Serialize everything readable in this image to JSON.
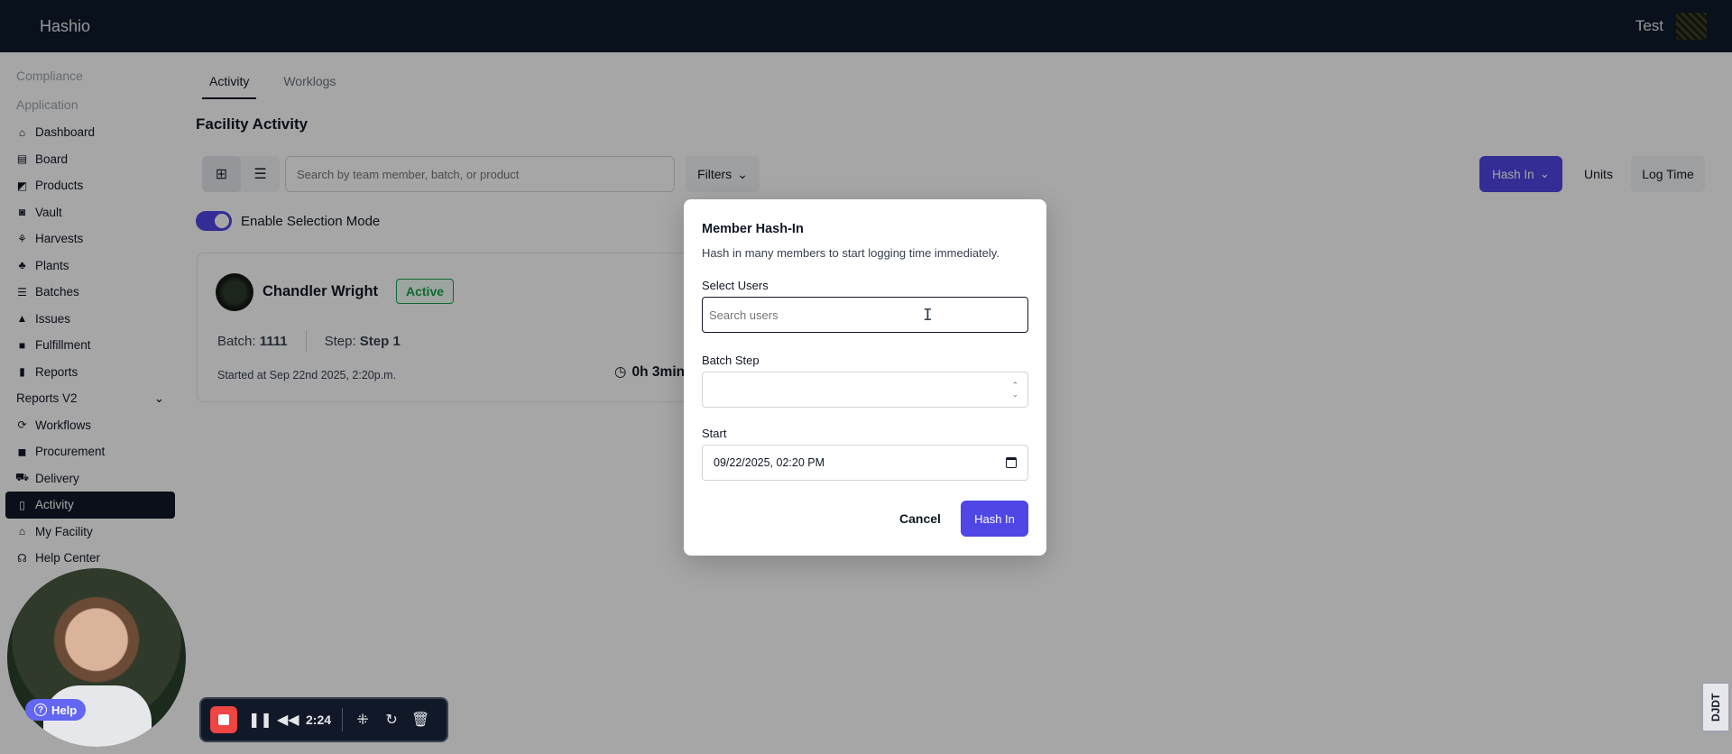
{
  "app": {
    "brand": "Hashio",
    "user_name": "Test"
  },
  "sidebar": {
    "sections": [
      "Compliance",
      "Application"
    ],
    "items": [
      {
        "label": "Dashboard",
        "icon": "home-icon",
        "glyph": "⌂"
      },
      {
        "label": "Board",
        "icon": "board-icon",
        "glyph": "▤"
      },
      {
        "label": "Products",
        "icon": "products-icon",
        "glyph": "◩"
      },
      {
        "label": "Vault",
        "icon": "vault-icon",
        "glyph": "◙"
      },
      {
        "label": "Harvests",
        "icon": "harvests-icon",
        "glyph": "⚘"
      },
      {
        "label": "Plants",
        "icon": "plants-icon",
        "glyph": "♣"
      },
      {
        "label": "Batches",
        "icon": "batches-icon",
        "glyph": "☰"
      },
      {
        "label": "Issues",
        "icon": "issues-icon",
        "glyph": "▲"
      },
      {
        "label": "Fulfillment",
        "icon": "fulfillment-icon",
        "glyph": "■"
      },
      {
        "label": "Reports",
        "icon": "reports-icon",
        "glyph": "▮"
      }
    ],
    "group_label": "Reports V2",
    "group_chevron": "⌄",
    "items2": [
      {
        "label": "Workflows",
        "icon": "workflows-icon",
        "glyph": "⟳"
      },
      {
        "label": "Procurement",
        "icon": "procurement-icon",
        "glyph": "◼"
      },
      {
        "label": "Delivery",
        "icon": "delivery-icon",
        "glyph": "⛟"
      },
      {
        "label": "Activity",
        "icon": "activity-icon",
        "glyph": "▯",
        "active": true
      },
      {
        "label": "My Facility",
        "icon": "facility-icon",
        "glyph": "⌂"
      },
      {
        "label": "Help Center",
        "icon": "help-center-icon",
        "glyph": "☊"
      }
    ]
  },
  "tabs": [
    "Activity",
    "Worklogs"
  ],
  "page_title": "Facility Activity",
  "toolbar": {
    "search_placeholder": "Search by team member, batch, or product",
    "filters_label": "Filters",
    "hash_in_label": "Hash In",
    "units_label": "Units",
    "log_time_label": "Log Time"
  },
  "selection_mode_label": "Enable Selection Mode",
  "card": {
    "name": "Chandler Wright",
    "status": "Active",
    "batch_label": "Batch:",
    "batch_value": "1111",
    "step_label": "Step:",
    "step_value": "Step 1",
    "started": "Started at Sep 22nd 2025, 2:20p.m.",
    "timer": "0h 3min"
  },
  "modal": {
    "title": "Member Hash-In",
    "description": "Hash in many members to start logging time immediately.",
    "select_users_label": "Select Users",
    "search_users_placeholder": "Search users",
    "batch_step_label": "Batch Step",
    "start_label": "Start",
    "start_value": "09/22/2025, 02:20 PM",
    "cancel_label": "Cancel",
    "hash_in_label": "Hash In"
  },
  "recorder": {
    "time": "2:24",
    "help_label": "Help"
  },
  "badge_text": "DJDT",
  "colors": {
    "topbar": "#0f1b2c",
    "accent": "#4f46e5",
    "active_green": "#16a34a"
  }
}
